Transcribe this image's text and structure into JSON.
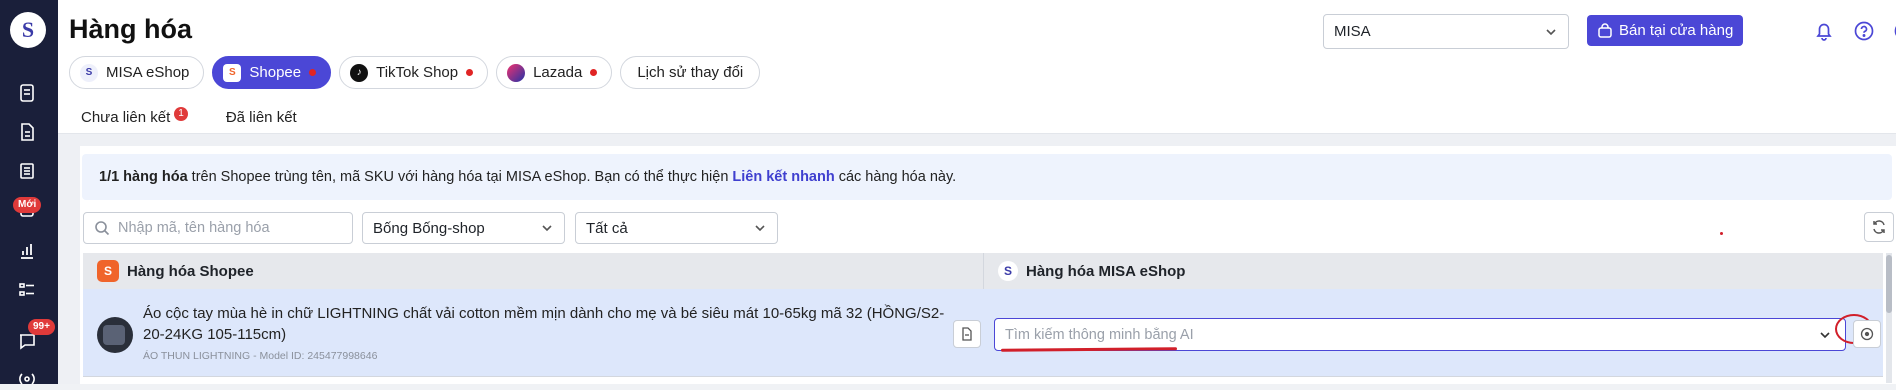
{
  "sidebar": {
    "logo_text": "S",
    "new_badge": "Mới",
    "chat_badge": "99+"
  },
  "page": {
    "title": "Hàng hóa"
  },
  "header": {
    "store_select_value": "MISA",
    "pos_button_label": "Bán tại cửa hàng"
  },
  "channel_tabs": [
    {
      "label": "MISA eShop"
    },
    {
      "label": "Shopee"
    },
    {
      "label": "TikTok Shop"
    },
    {
      "label": "Lazada"
    },
    {
      "label": "Lịch sử thay đổi"
    }
  ],
  "sub_tabs": {
    "unlinked_label": "Chưa liên kết",
    "unlinked_count": "1",
    "linked_label": "Đã liên kết"
  },
  "info": {
    "count_text": "1/1 hàng hóa",
    "text_part1": "trên Shopee trùng tên, mã SKU với hàng hóa tại MISA eShop. Bạn có thể thực hiện",
    "link_text": "Liên kết nhanh",
    "text_part2": "các hàng hóa này."
  },
  "filters": {
    "search_placeholder": "Nhập mã, tên hàng hóa",
    "shop_select_value": "Bống Bống-shop",
    "status_select_value": "Tất cả"
  },
  "table": {
    "col_shopee": "Hàng hóa Shopee",
    "col_misa": "Hàng hóa MISA eShop",
    "rows": [
      {
        "name": "Áo cộc tay mùa hè in chữ LIGHTNING chất vải cotton mềm mịn dành cho mẹ và bé siêu mát 10-65kg mã 32 (HỒNG/S2-20-24KG 105-115cm)",
        "meta": "ÁO THUN LIGHTNING - Model ID: 245477998646",
        "ai_placeholder": "Tìm kiếm thông minh bằng AI"
      }
    ]
  },
  "colors": {
    "accent": "#4b47d6",
    "sidebar_bg": "#1a1f3a",
    "annotation_red": "#d11f2a",
    "shopee_orange": "#f0642a"
  }
}
